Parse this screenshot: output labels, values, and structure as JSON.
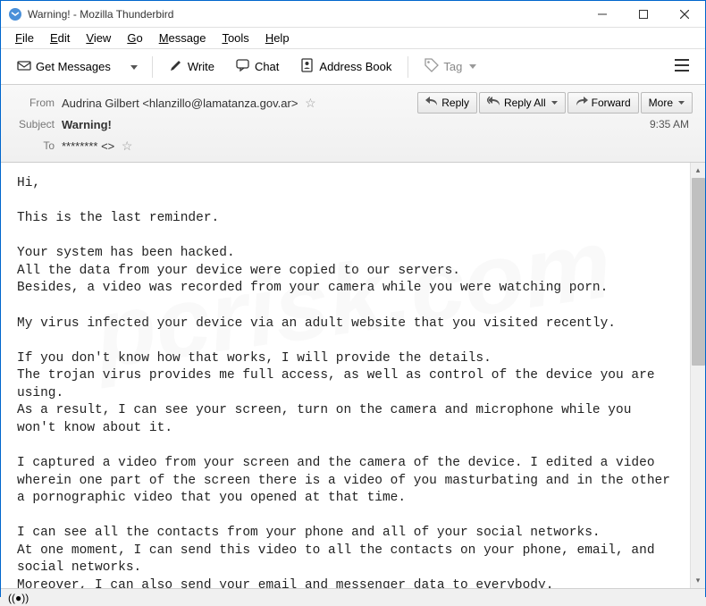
{
  "window": {
    "title": "Warning! - Mozilla Thunderbird"
  },
  "menu": {
    "file": "File",
    "edit": "Edit",
    "view": "View",
    "go": "Go",
    "message": "Message",
    "tools": "Tools",
    "help": "Help"
  },
  "toolbar": {
    "get_messages": "Get Messages",
    "write": "Write",
    "chat": "Chat",
    "address_book": "Address Book",
    "tag": "Tag"
  },
  "header": {
    "from_label": "From",
    "from_value": "Audrina Gilbert <hlanzillo@lamatanza.gov.ar>",
    "subject_label": "Subject",
    "subject_value": "Warning!",
    "to_label": "To",
    "to_value": "******** <>",
    "timestamp": "9:35 AM"
  },
  "actions": {
    "reply": "Reply",
    "reply_all": "Reply All",
    "forward": "Forward",
    "more": "More"
  },
  "body": "Hi,\n\nThis is the last reminder.\n\nYour system has been hacked.\nAll the data from your device were copied to our servers.\nBesides, a video was recorded from your camera while you were watching porn.\n\nMy virus infected your device via an adult website that you visited recently.\n\nIf you don't know how that works, I will provide the details.\nThe trojan virus provides me full access, as well as control of the device you are using.\nAs a result, I can see your screen, turn on the camera and microphone while you won't know about it.\n\nI captured a video from your screen and the camera of the device. I edited a video wherein one part of the screen there is a video of you masturbating and in the other a pornographic video that you opened at that time.\n\nI can see all the contacts from your phone and all of your social networks.\nAt one moment, I can send this video to all the contacts on your phone, email, and social networks.\nMoreover, I can also send your email and messenger data to everybody.\n\nI can destroy your reputation forever."
}
